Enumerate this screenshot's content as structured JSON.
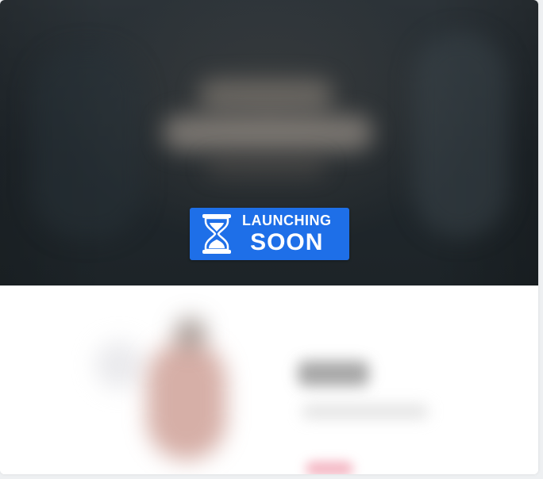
{
  "badge": {
    "line1": "LAUNCHING",
    "line2": "SOON",
    "icon": "hourglass-icon",
    "color": "#1e6fe8"
  },
  "hero": {
    "background_color": "#22292e"
  }
}
